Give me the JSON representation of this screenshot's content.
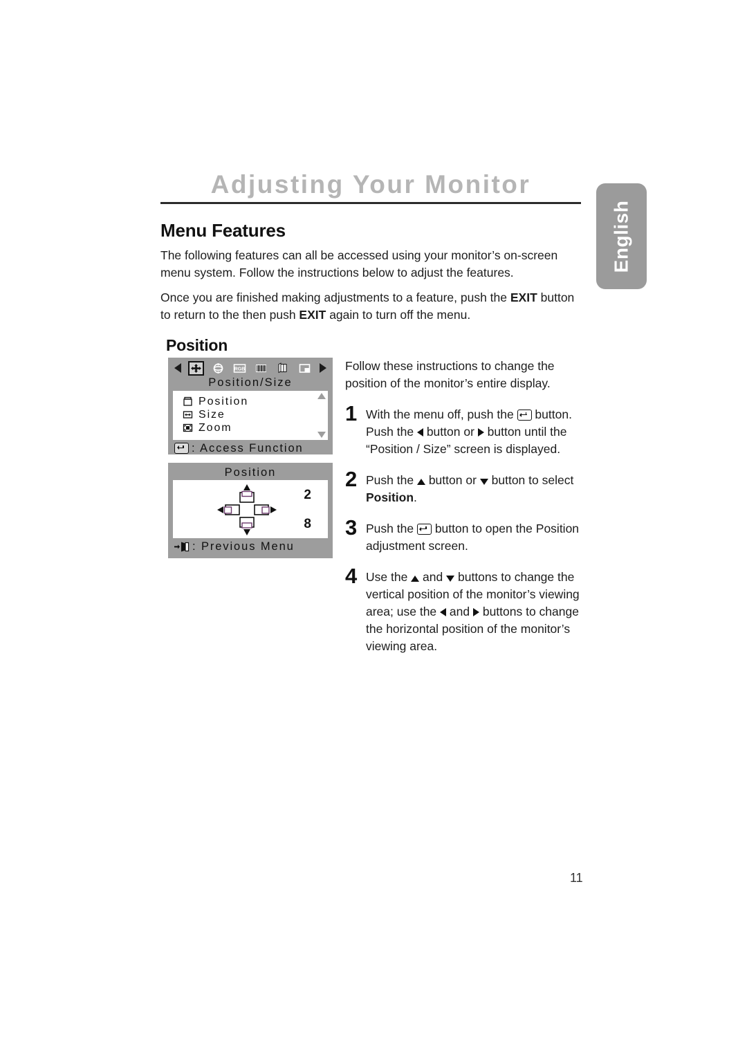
{
  "page": {
    "chapter_title": "Adjusting Your Monitor",
    "language_tab": "English",
    "page_number": "11"
  },
  "content": {
    "section_heading": "Menu Features",
    "intro_paragraph": "The following features can all be accessed using your monitor’s on-screen menu system. Follow the instructions below to adjust the features.",
    "exit_paragraph_part1": "Once you are finished making adjustments to a feature, push the ",
    "exit_label_1": "EXIT",
    "exit_paragraph_part2": " button to return to the then push ",
    "exit_label_2": "EXIT",
    "exit_paragraph_part3": " again to turn off the menu.",
    "subsection_heading": "Position"
  },
  "osd_menu": {
    "icons": [
      {
        "name": "position-size-icon",
        "label": "Position/Size",
        "selected": true
      },
      {
        "name": "rotation-icon",
        "label": "Rotation",
        "selected": false
      },
      {
        "name": "rgb-icon",
        "label": "RGB",
        "selected": false
      },
      {
        "name": "moire-icon",
        "label": "Moire",
        "selected": false
      },
      {
        "name": "osd-pages-icon",
        "label": "Pages",
        "selected": false
      },
      {
        "name": "layout-icon",
        "label": "Layout",
        "selected": false
      }
    ],
    "title": "Position/Size",
    "items": [
      {
        "icon": "position-item-icon",
        "label": "Position"
      },
      {
        "icon": "size-item-icon",
        "label": "Size"
      },
      {
        "icon": "zoom-item-icon",
        "label": "Zoom"
      }
    ],
    "footer_label": ": Access Function",
    "footer_key": "enter-key-icon",
    "scroll_up": "scroll-up-arrow",
    "scroll_down": "scroll-down-arrow",
    "prev_arrow": "left-arrow-icon",
    "next_arrow": "right-arrow-icon"
  },
  "osd_position": {
    "title": "Position",
    "vertical_value": "2",
    "horizontal_value": "8",
    "footer_label": ": Previous Menu",
    "footer_key": "exit-door-icon"
  },
  "instructions": {
    "intro": "Follow these instructions to change the position of the monitor’s entire display.",
    "steps": [
      {
        "number": "1",
        "part1": "With the menu off, push the ",
        "key1": "enter-key-icon",
        "part2": " button. Push the ",
        "key2": "left-triangle-icon",
        "part3": " button or ",
        "key3": "right-triangle-icon",
        "part4": " button until the “Position / Size” screen is displayed."
      },
      {
        "number": "2",
        "part1": "Push the ",
        "key1": "up-triangle-icon",
        "part2": " button or ",
        "key2": "down-triangle-icon",
        "part3": " button to select ",
        "bold": "Position",
        "part4": "."
      },
      {
        "number": "3",
        "part1": "Push the ",
        "key1": "enter-key-icon",
        "part2": " button to open the Position adjustment screen."
      },
      {
        "number": "4",
        "part1": "Use the ",
        "key1": "up-triangle-icon",
        "part2": " and ",
        "key2": "down-triangle-icon",
        "part3": " buttons to change the vertical position of the monitor’s viewing area; use the ",
        "key3": "left-triangle-icon",
        "part4": " and ",
        "key4": "right-triangle-icon",
        "part5": " buttons to change the horizontal position of the monitor’s viewing area."
      }
    ]
  },
  "colors": {
    "title_gray": "#b5b5b5",
    "tab_gray": "#9b9b9b",
    "osd_gray": "#9d9d9d",
    "text_black": "#1a1a1a",
    "rule_black": "#2b2b2b"
  }
}
